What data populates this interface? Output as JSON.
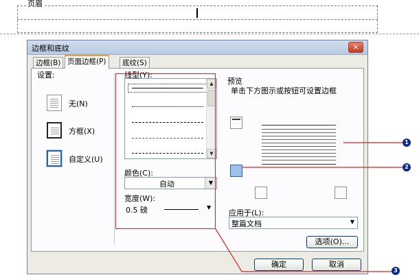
{
  "document": {
    "header_label": "页眉"
  },
  "dialog": {
    "title": "边框和底纹",
    "close_label": "×",
    "tabs": [
      {
        "label": "边框(B)",
        "active": false
      },
      {
        "label": "页面边框(P)",
        "active": true
      },
      {
        "label": "底纹(S)",
        "active": false
      }
    ],
    "settings": {
      "label": "设置:",
      "items": [
        {
          "label": "无(N)",
          "selected": false
        },
        {
          "label": "方框(X)",
          "selected": false
        },
        {
          "label": "自定义(U)",
          "selected": true
        }
      ]
    },
    "line_style": {
      "label": "线型(Y):",
      "options": [
        "solid",
        "dotted",
        "dashed-small",
        "dash-dot",
        "dash-long"
      ]
    },
    "color": {
      "label": "颜色(C):",
      "value": "自动"
    },
    "width": {
      "label": "宽度(W):",
      "value": "0.5 磅"
    },
    "preview": {
      "label": "预览",
      "hint": "单击下方图示或按钮可设置边框"
    },
    "apply_to": {
      "label": "应用于(L):",
      "value": "整篇文档"
    },
    "options_button": "选项(O)...",
    "ok_button": "确定",
    "cancel_button": "取消"
  },
  "callouts": [
    "1",
    "2",
    "3"
  ],
  "colors": {
    "accent": "#2a5fb0",
    "callout": "#0b2c8c",
    "highlight": "#dd2222"
  }
}
